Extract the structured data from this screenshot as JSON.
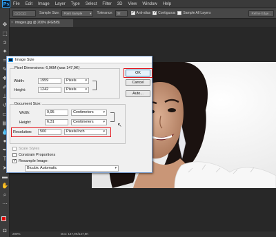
{
  "app": {
    "logo": "Ps",
    "menu": [
      "File",
      "Edit",
      "Image",
      "Layer",
      "Type",
      "Select",
      "Filter",
      "3D",
      "View",
      "Window",
      "Help"
    ]
  },
  "options_bar": {
    "sample_size_label": "Sample Size:",
    "sample_size_value": "Point Sample",
    "tolerance_label": "Tolerance:",
    "tolerance_value": "32",
    "antialias_label": "Anti-alias",
    "contiguous_label": "Contiguous",
    "sample_all_layers_label": "Sample All Layers",
    "refine_edge_label": "Refine Edge..."
  },
  "document_tab": {
    "title": "images.jpg @ 200% (RGB/8)"
  },
  "status_bar": {
    "zoom": "200%",
    "doc_info": "Doc: 147,9K/147,9K"
  },
  "colors": {
    "foreground": "#e00000",
    "background": "#ffffff",
    "highlight": "#e3161d"
  },
  "dialog": {
    "title": "Image Size",
    "pixel_dimensions": {
      "label": "Pixel Dimensions: 6,96M (was 147,9K)",
      "width_label": "Width:",
      "width_value": "1959",
      "width_unit": "Pixels",
      "height_label": "Height:",
      "height_value": "1242",
      "height_unit": "Pixels"
    },
    "document_size": {
      "label": "Document Size:",
      "width_label": "Width:",
      "width_value": "9,95",
      "width_unit": "Centimeters",
      "height_label": "Height:",
      "height_value": "6,31",
      "height_unit": "Centimeters",
      "resolution_label": "Resolution:",
      "resolution_value": "500",
      "resolution_unit": "Pixels/Inch"
    },
    "scale_styles_label": "Scale Styles",
    "constrain_proportions_label": "Constrain Proportions",
    "resample_image_label": "Resample Image:",
    "resample_method": "Bicubic Automatic",
    "buttons": {
      "ok": "OK",
      "cancel": "Cancel",
      "auto": "Auto..."
    }
  }
}
